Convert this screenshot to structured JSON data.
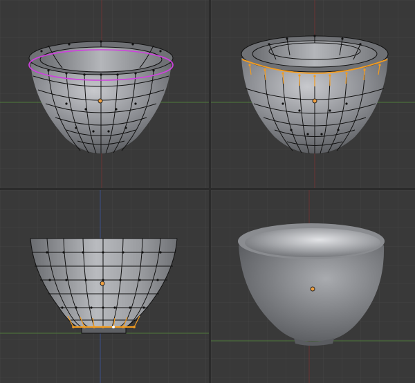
{
  "app": {
    "name": "3d-editor-quad-view"
  },
  "colors": {
    "viewport_bg": "#393939",
    "grid_line": "#414141",
    "axis_x": "#4f7a3c",
    "axis_y": "#7a3c3c",
    "axis_z": "#3c4f8a",
    "mesh_fill": "#8f9196",
    "mesh_wire": "#111111",
    "edge_loop_selected": "#d040e0",
    "edge_selected_orange": "#f39c1f",
    "origin_dot": "#f0a040"
  },
  "viewports": [
    {
      "id": "top-left",
      "mode": "edit",
      "selection": "edge-loop-magenta"
    },
    {
      "id": "top-right",
      "mode": "edit",
      "selection": "rim-edges-orange"
    },
    {
      "id": "bottom-left",
      "mode": "edit",
      "selection": "bottom-edges-orange"
    },
    {
      "id": "bottom-right",
      "mode": "object",
      "selection": "none"
    }
  ]
}
